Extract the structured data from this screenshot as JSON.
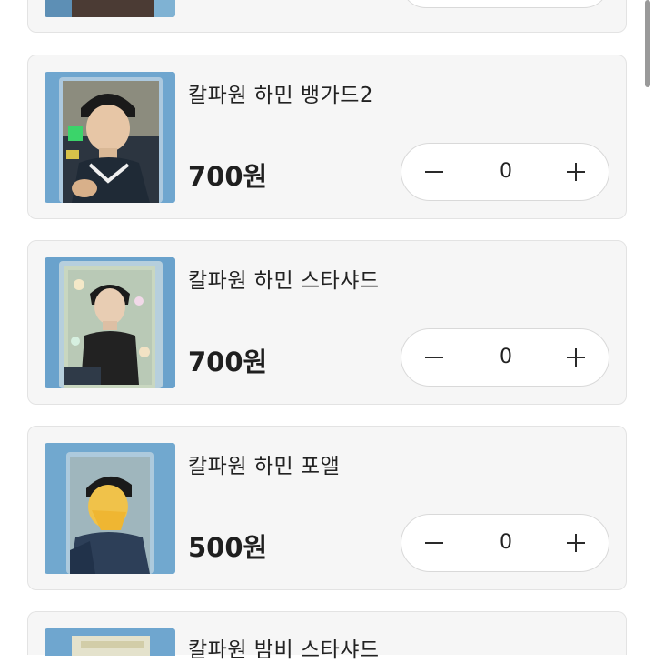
{
  "products": [
    {
      "name": "",
      "price": "",
      "quantity": ""
    },
    {
      "name": "칼파원 하민 뱅가드2",
      "price": "700원",
      "quantity": "0"
    },
    {
      "name": "칼파원 하민 스타샤드",
      "price": "700원",
      "quantity": "0"
    },
    {
      "name": "칼파원 하민 포앨",
      "price": "500원",
      "quantity": "0"
    },
    {
      "name": "칼파원 밤비 스타샤드",
      "price": "",
      "quantity": ""
    }
  ],
  "icons": {
    "minus": "minus-icon",
    "plus": "plus-icon"
  },
  "colors": {
    "card_background": "#f6f6f6",
    "card_border": "#e3e3e3",
    "stepper_background": "#ffffff",
    "text": "#222222"
  }
}
